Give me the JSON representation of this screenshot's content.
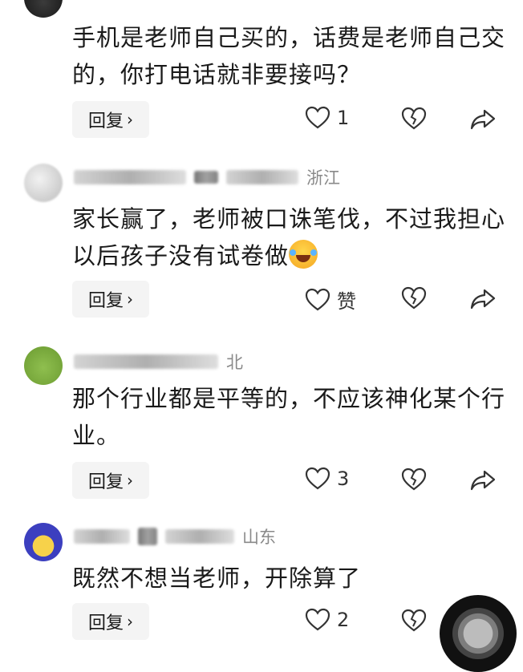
{
  "comments": [
    {
      "region": "",
      "text": "手机是老师自己买的，话费是老师自己交的，你打电话就非要接吗？",
      "reply_label": "回复",
      "likes": "1"
    },
    {
      "region": "浙江",
      "text": "家长赢了，老师被口诛笔伐，不过我担心以后孩子没有试卷做",
      "reply_label": "回复",
      "likes": "赞"
    },
    {
      "region": "北",
      "text": "那个行业都是平等的，不应该神化某个行业。",
      "reply_label": "回复",
      "likes": "3"
    },
    {
      "region": "山东",
      "text": "既然不想当老师，开除算了",
      "reply_label": "回复",
      "likes": "2"
    }
  ],
  "icons": {
    "like": "heart-outline-icon",
    "dislike": "broken-heart-icon",
    "share": "share-arrow-icon",
    "reply_chevron": "chevron-right-icon"
  },
  "colors": {
    "background": "#ffffff",
    "text": "#1a1a1a",
    "region": "#8a8a8a",
    "reply_bg": "#f4f4f4"
  }
}
